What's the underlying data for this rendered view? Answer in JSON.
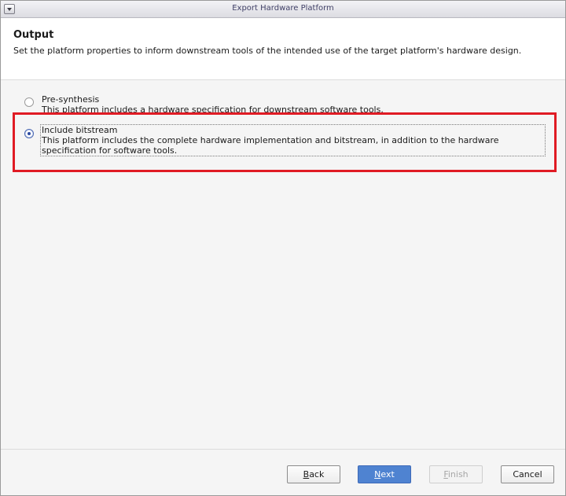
{
  "window": {
    "title": "Export Hardware Platform"
  },
  "header": {
    "title": "Output",
    "description": "Set the platform properties to inform downstream tools of the intended use of the target platform's hardware design."
  },
  "options": [
    {
      "label": "Pre-synthesis",
      "description": "This platform includes a hardware specification for downstream software tools.",
      "selected": false
    },
    {
      "label": "Include bitstream",
      "description_line1": "This platform includes the complete hardware implementation and bitstream, in addition to the hardware",
      "description_line2": "specification for software tools.",
      "selected": true
    }
  ],
  "buttons": {
    "back": {
      "mnemonic": "B",
      "rest": "ack",
      "enabled": true
    },
    "next": {
      "mnemonic": "N",
      "rest": "ext",
      "enabled": true
    },
    "finish": {
      "mnemonic": "F",
      "rest": "inish",
      "enabled": false
    },
    "cancel": {
      "label": "Cancel",
      "enabled": true
    }
  },
  "colors": {
    "highlight": "#e01b24",
    "primary_button": "#4f83d1",
    "radio_selected": "#2b4aa0"
  },
  "icons": {
    "window_menu": "chevron-down-icon"
  }
}
